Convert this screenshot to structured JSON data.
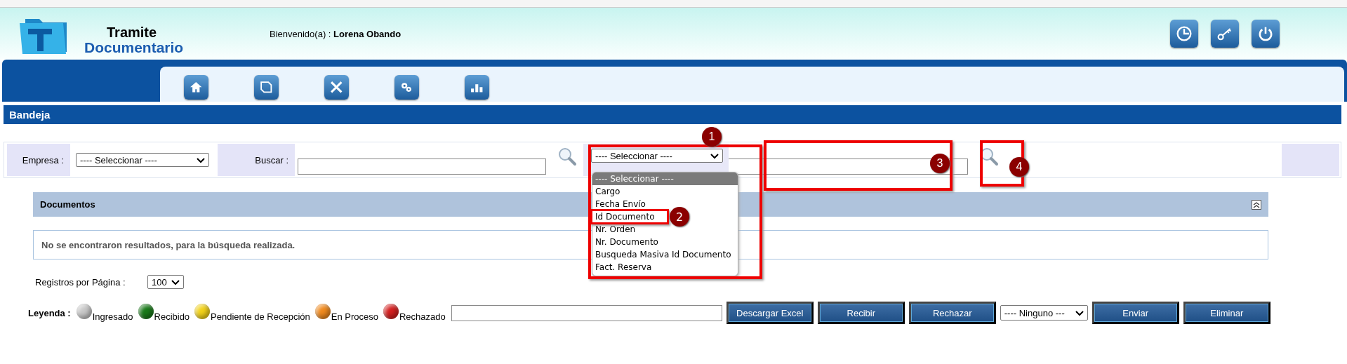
{
  "header": {
    "logo_line1": "Tramite",
    "logo_line2": "Documentario",
    "welcome_label": "Bienvenido(a) :",
    "user_name": "Lorena Obando",
    "icons": [
      {
        "kind": "clock"
      },
      {
        "kind": "key"
      },
      {
        "kind": "power"
      }
    ]
  },
  "nav": {
    "icons": [
      {
        "kind": "home"
      },
      {
        "kind": "document"
      },
      {
        "kind": "tools"
      },
      {
        "kind": "gears"
      },
      {
        "kind": "chart"
      }
    ]
  },
  "page_title": "Bandeja",
  "filters": {
    "empresa_label": "Empresa :",
    "empresa_select": "---- Seleccionar ----",
    "buscar_label": "Buscar :",
    "field_select": "---- Seleccionar ----",
    "field_options": [
      {
        "label": "---- Seleccionar ----",
        "selected": true
      },
      {
        "label": "Cargo",
        "selected": false
      },
      {
        "label": "Fecha Envío",
        "selected": false
      },
      {
        "label": "Id Documento",
        "selected": false
      },
      {
        "label": "Nr. Orden",
        "selected": false
      },
      {
        "label": "Nr. Documento",
        "selected": false
      },
      {
        "label": "Busqueda Masiva Id Documento",
        "selected": false
      },
      {
        "label": "Fact. Reserva",
        "selected": false
      }
    ]
  },
  "annotations": [
    {
      "number": "1"
    },
    {
      "number": "2"
    },
    {
      "number": "3"
    },
    {
      "number": "4"
    }
  ],
  "documents": {
    "title": "Documentos",
    "message": "No se encontraron resultados, para la búsqueda realizada."
  },
  "pagination": {
    "label": "Registros por Página :",
    "per_page": "100"
  },
  "legend": {
    "label": "Leyenda :",
    "items": [
      {
        "name": "Ingresado",
        "color": "#c8c8c8"
      },
      {
        "name": "Recibido",
        "color": "#1a7a1a"
      },
      {
        "name": "Pendiente de Recepción",
        "color": "#f2d21a"
      },
      {
        "name": "En Proceso",
        "color": "#f08a1e"
      },
      {
        "name": "Rechazado",
        "color": "#d42020"
      }
    ]
  },
  "actions": {
    "buttons_left": [
      "Descargar Excel",
      "Recibir",
      "Rechazar"
    ],
    "assign_select": "---- Ninguno ---",
    "buttons_right": [
      "Enviar",
      "Eliminar"
    ]
  }
}
